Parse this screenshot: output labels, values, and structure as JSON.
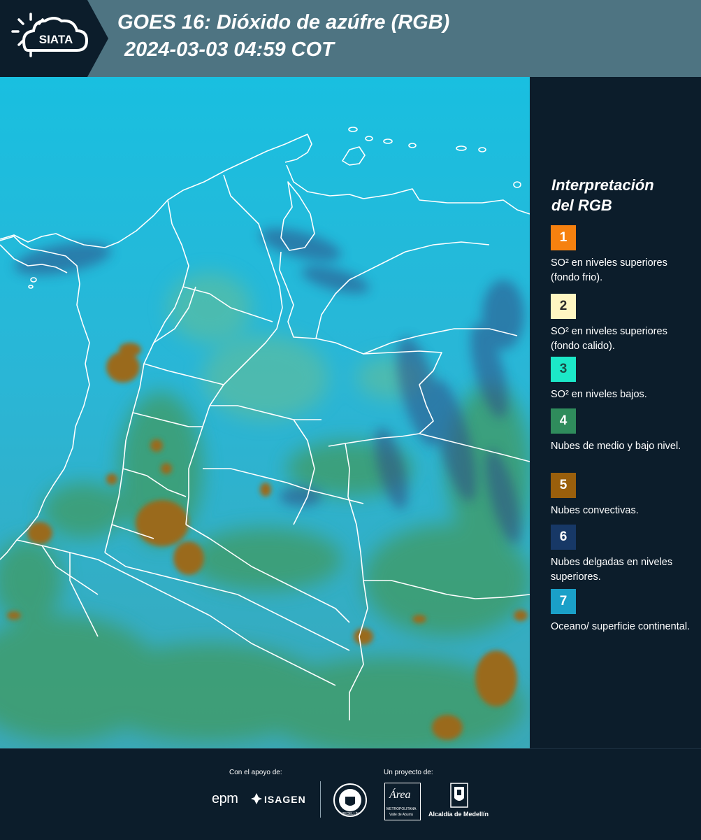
{
  "header": {
    "logo_text": "SIATA",
    "title_line1": "GOES 16: Dióxido de azúfre (RGB)",
    "title_line2": "2024-03-03 04:59 COT"
  },
  "legend": {
    "title_line1": "Interpretación",
    "title_line2": "del RGB",
    "items": [
      {
        "number": "1",
        "color": "#f6810f",
        "text_color": "#ffffff",
        "label": "SO² en niveles superiores (fondo frio)."
      },
      {
        "number": "2",
        "color": "#fff6c2",
        "text_color": "#2b2b2b",
        "label": "SO² en niveles superiores (fondo calido)."
      },
      {
        "number": "3",
        "color": "#1ce8c8",
        "text_color": "#1c4b45",
        "label": "SO² en niveles bajos."
      },
      {
        "number": "4",
        "color": "#2f8c5c",
        "text_color": "#ffffff",
        "label": "Nubes de medio y bajo nivel."
      },
      {
        "number": "5",
        "color": "#9a5f0c",
        "text_color": "#ffffff",
        "label": "Nubes convectivas."
      },
      {
        "number": "6",
        "color": "#173866",
        "text_color": "#ffffff",
        "label": "Nubes delgadas en niveles superiores."
      },
      {
        "number": "7",
        "color": "#1aa0c8",
        "text_color": "#ffffff",
        "label": "Oceano/ superficie continental."
      }
    ]
  },
  "footer": {
    "support_label": "Con el apoyo de:",
    "project_label": "Un proyecto de:",
    "sponsor1": "epm",
    "sponsor2": "ISAGEN",
    "partner1_caption": "MEDELLÍN",
    "partner2_caption": "Área",
    "partner2_sub": "METROPOLITANA",
    "partner2_sub2": "Valle de Aburrá",
    "partner3_caption": "Alcaldía de Medellín"
  }
}
